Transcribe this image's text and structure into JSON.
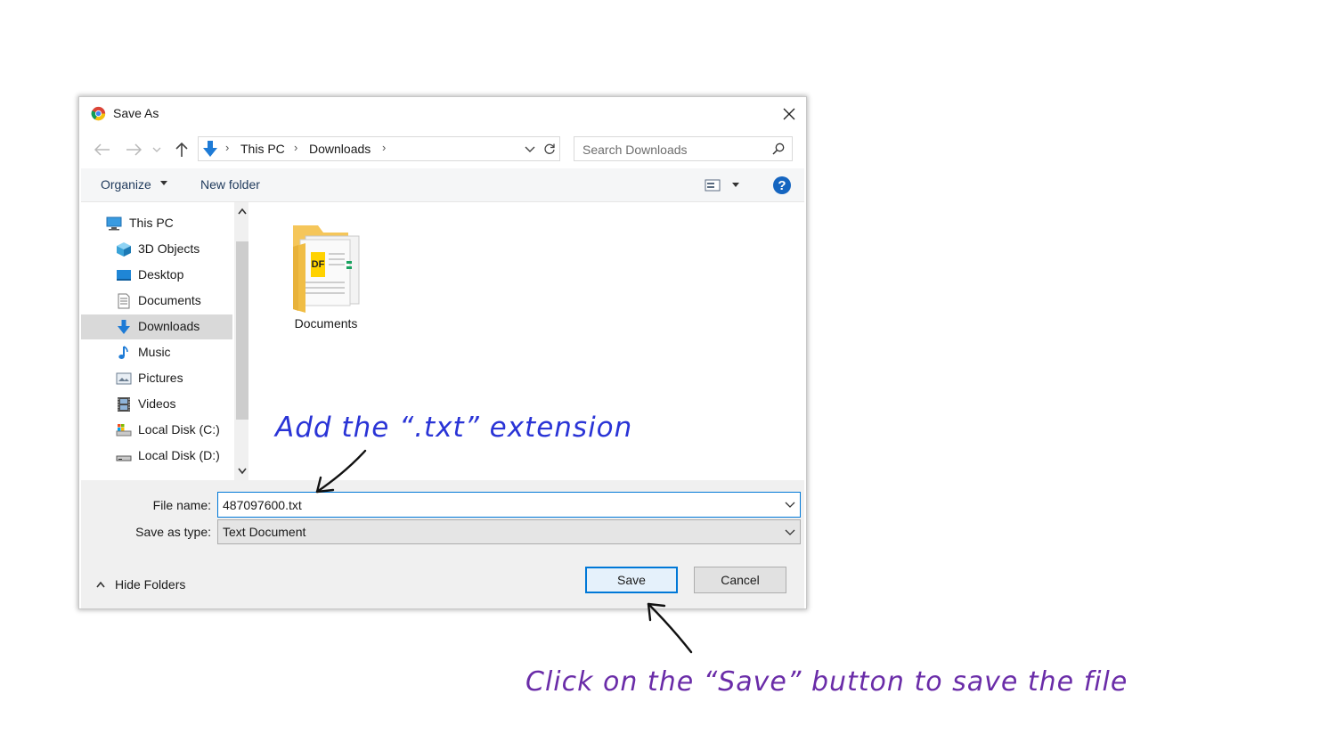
{
  "window": {
    "title": "Save As"
  },
  "address_bar": {
    "breadcrumb": [
      "This PC",
      "Downloads"
    ],
    "separator": "›"
  },
  "search": {
    "placeholder": "Search Downloads"
  },
  "toolbar": {
    "organize_label": "Organize",
    "new_folder_label": "New folder"
  },
  "nav_pane": {
    "items": [
      {
        "label": "This PC",
        "icon": "computer-icon",
        "selected": false
      },
      {
        "label": "3D Objects",
        "icon": "cube-icon",
        "selected": false
      },
      {
        "label": "Desktop",
        "icon": "desktop-icon",
        "selected": false
      },
      {
        "label": "Documents",
        "icon": "document-icon",
        "selected": false
      },
      {
        "label": "Downloads",
        "icon": "download-icon",
        "selected": true
      },
      {
        "label": "Music",
        "icon": "music-note-icon",
        "selected": false
      },
      {
        "label": "Pictures",
        "icon": "pictures-icon",
        "selected": false
      },
      {
        "label": "Videos",
        "icon": "film-icon",
        "selected": false
      },
      {
        "label": "Local Disk (C:)",
        "icon": "drive-icon",
        "selected": false
      },
      {
        "label": "Local Disk (D:)",
        "icon": "drive-icon",
        "selected": false
      }
    ]
  },
  "content": {
    "folders": [
      {
        "label": "Documents",
        "icon": "folder-icon"
      }
    ]
  },
  "file_name": {
    "label": "File name:",
    "value": "487097600.txt"
  },
  "save_as_type": {
    "label": "Save as type:",
    "value": "Text Document"
  },
  "hide_folders_label": "Hide Folders",
  "buttons": {
    "save": "Save",
    "cancel": "Cancel"
  },
  "annotations": {
    "extension_note": "Add the “.txt” extension",
    "save_note": "Click on the “Save” button to save the file"
  },
  "colors": {
    "accent": "#0078d7",
    "annotation_blue": "#2a34d6",
    "annotation_purple": "#6a2ca8",
    "selected_bg": "#d9d9d9"
  }
}
